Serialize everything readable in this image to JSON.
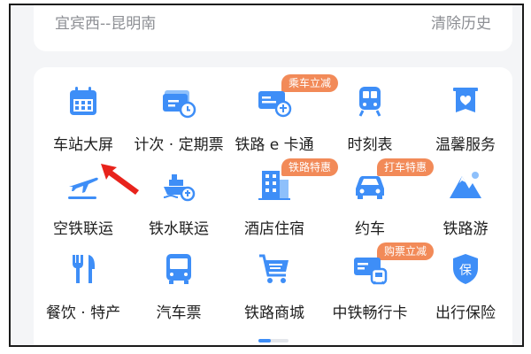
{
  "colors": {
    "accent": "#3e8ef7",
    "badge": "#f28a58"
  },
  "history": {
    "route": "宜宾西--昆明南",
    "clear_label": "清除历史"
  },
  "services": [
    {
      "label": "车站大屏",
      "icon": "calendar-grid-icon",
      "badge": ""
    },
    {
      "label": "计次 · 定期票",
      "icon": "ticket-card-clock-icon",
      "badge": ""
    },
    {
      "label": "铁路 e 卡通",
      "icon": "railway-card-icon",
      "badge": "乘车立减"
    },
    {
      "label": "时刻表",
      "icon": "train-front-icon",
      "badge": ""
    },
    {
      "label": "温馨服务",
      "icon": "heart-banner-icon",
      "badge": ""
    },
    {
      "label": "空铁联运",
      "icon": "airplane-icon",
      "badge": ""
    },
    {
      "label": "铁水联运",
      "icon": "ship-icon",
      "badge": ""
    },
    {
      "label": "酒店住宿",
      "icon": "hotel-building-icon",
      "badge": "铁路特惠"
    },
    {
      "label": "约车",
      "icon": "car-icon",
      "badge": "打车特惠"
    },
    {
      "label": "铁路游",
      "icon": "mountain-icon",
      "badge": ""
    },
    {
      "label": "餐饮 · 特产",
      "icon": "fork-knife-icon",
      "badge": ""
    },
    {
      "label": "汽车票",
      "icon": "bus-icon",
      "badge": ""
    },
    {
      "label": "铁路商城",
      "icon": "shopping-cart-icon",
      "badge": ""
    },
    {
      "label": "中铁畅行卡",
      "icon": "card-train-icon",
      "badge": "购票立减"
    },
    {
      "label": "出行保险",
      "icon": "insurance-shield-icon",
      "badge": ""
    }
  ]
}
